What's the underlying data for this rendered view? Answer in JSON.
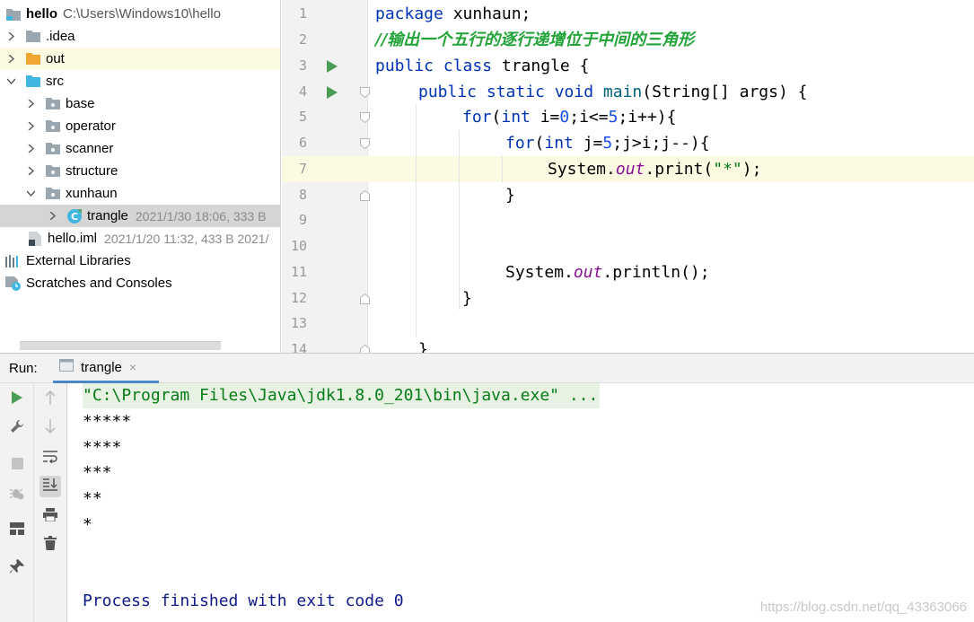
{
  "project": {
    "root": {
      "name": "hello",
      "path": "C:\\Users\\Windows10\\hello"
    },
    "items": [
      {
        "label": ".idea"
      },
      {
        "label": "out"
      },
      {
        "label": "src"
      },
      {
        "label": "base"
      },
      {
        "label": "operator"
      },
      {
        "label": "scanner"
      },
      {
        "label": "structure"
      },
      {
        "label": "xunhaun"
      },
      {
        "label": "trangle",
        "meta": "2021/1/30 18:06, 333 B"
      },
      {
        "label": "hello.iml",
        "meta": "2021/1/20 11:32, 433 B 2021/"
      },
      {
        "label": "External Libraries"
      },
      {
        "label": "Scratches and Consoles"
      }
    ]
  },
  "editor": {
    "line_numbers": [
      "1",
      "2",
      "3",
      "4",
      "5",
      "6",
      "7",
      "8",
      "9",
      "10",
      "11",
      "12",
      "13",
      "14"
    ],
    "code": {
      "l1_kw": "package",
      "l1_rest": " xunhaun;",
      "l2_comment": "//输出一个五行的逐行递增位于中间的三角形",
      "l3_kw": "public class",
      "l3_rest": " trangle {",
      "l4_kw": "public static void",
      "l4_method": " main",
      "l4_rest": "(String[] args) {",
      "l5_kw": "for",
      "l5_a": "(",
      "l5_int": "int",
      "l5_b": " i=",
      "l5_n0": "0",
      "l5_c": ";i<=",
      "l5_n5": "5",
      "l5_d": ";i++){",
      "l6_kw": "for",
      "l6_a": "(",
      "l6_int": "int",
      "l6_b": " j=",
      "l6_n5": "5",
      "l6_c": ";j>i;j--){",
      "l7_a": "System.",
      "l7_out": "out",
      "l7_b": ".print(",
      "l7_str": "\"*\"",
      "l7_c": ");",
      "l8": "}",
      "l11_a": "System.",
      "l11_out": "out",
      "l11_b": ".println();",
      "l12": "}",
      "l14": "}"
    }
  },
  "run": {
    "label": "Run:",
    "tab": "trangle",
    "tab_close": "×",
    "console": {
      "command": "\"C:\\Program Files\\Java\\jdk1.8.0_201\\bin\\java.exe\" ...",
      "lines": [
        "*****",
        "****",
        "***",
        "**",
        "*"
      ],
      "exit": "Process finished with exit code 0"
    }
  },
  "watermark": "https://blog.csdn.net/qq_43363066",
  "colors": {
    "keyword": "#0033b3",
    "comment": "#21a337",
    "number": "#1750eb",
    "field": "#871094",
    "string": "#067d17",
    "run_green": "#499c54",
    "selection": "#d5d5d5",
    "current_line": "#fcfbe2"
  },
  "icons": [
    "project-folder-icon",
    "folder-icon",
    "excluded-folder-icon",
    "source-folder-icon",
    "package-icon",
    "java-class-icon",
    "module-file-icon",
    "libraries-icon",
    "scratches-icon",
    "run-icon",
    "wrench-icon",
    "stop-icon",
    "debug-icon",
    "layout-icon",
    "pin-icon",
    "up-arrow-icon",
    "down-arrow-icon",
    "soft-wrap-icon",
    "scroll-to-end-icon",
    "print-icon",
    "trash-icon",
    "console-tab-icon"
  ]
}
